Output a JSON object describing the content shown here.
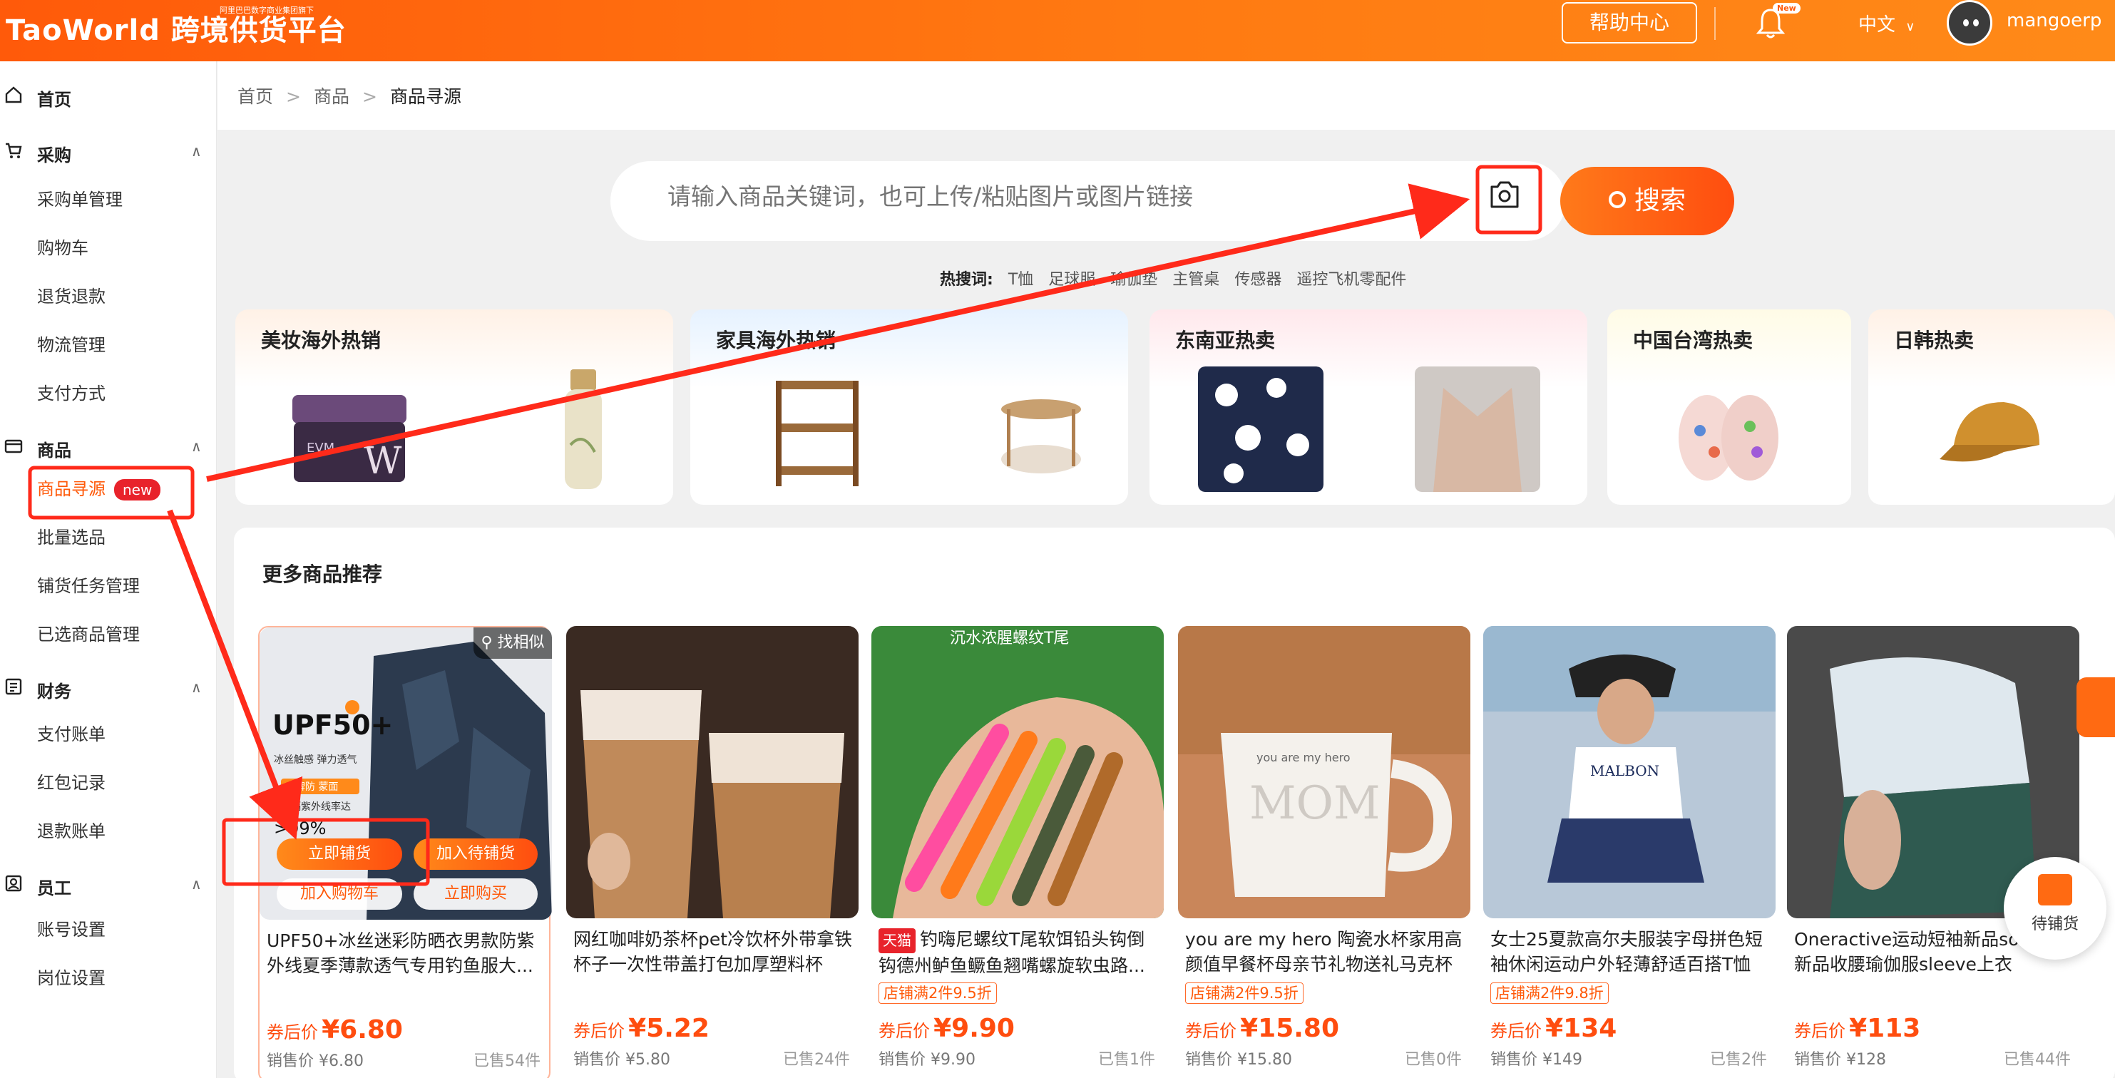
{
  "header": {
    "logo_text": "TaoWorld 跨境供货平台",
    "logo_tagline": "阿里巴巴数字商业集团旗下",
    "help_label": "帮助中心",
    "bell_badge": "New",
    "language": "中文",
    "username": "mangoerp"
  },
  "sidebar": {
    "home": "首页",
    "groups": [
      {
        "title": "采购",
        "items": [
          "采购单管理",
          "购物车",
          "退货退款",
          "物流管理",
          "支付方式"
        ]
      },
      {
        "title": "商品",
        "items": [
          "商品寻源",
          "批量选品",
          "铺货任务管理",
          "已选商品管理"
        ]
      },
      {
        "title": "财务",
        "items": [
          "支付账单",
          "红包记录",
          "退款账单"
        ]
      },
      {
        "title": "员工",
        "items": [
          "账号设置",
          "岗位设置"
        ]
      }
    ],
    "active_badge": "new"
  },
  "breadcrumb": [
    "首页",
    "商品",
    "商品寻源"
  ],
  "search": {
    "placeholder": "请输入商品关键词，也可上传/粘贴图片或图片链接",
    "button_label": "搜索",
    "hot_label": "热搜词:",
    "hot_words": [
      "T恤",
      "足球服",
      "瑜伽垫",
      "主管桌",
      "传感器",
      "遥控飞机零配件"
    ]
  },
  "categories": [
    "美妆海外热销",
    "家具海外热销",
    "东南亚热卖",
    "中国台湾热卖",
    "日韩热卖"
  ],
  "recommend": {
    "title": "更多商品推荐",
    "find_similar": "找相似",
    "btn_list_now": "立即铺货",
    "btn_add_pending": "加入待铺货",
    "btn_add_cart": "加入购物车",
    "btn_buy_now": "立即购买",
    "products": [
      {
        "title": "UPF50+冰丝迷彩防晒衣男款防紫外线夏季薄款透气专用钓鱼服大...",
        "promo": "",
        "price_label": "券后价",
        "price": "¥6.80",
        "sale_price": "销售价 ¥6.80",
        "sold": "已售54件"
      },
      {
        "title": "网红咖啡奶茶杯pet冷饮杯外带拿铁杯子一次性带盖打包加厚塑料杯",
        "promo": "",
        "price_label": "券后价",
        "price": "¥5.22",
        "sale_price": "销售价 ¥5.80",
        "sold": "已售24件"
      },
      {
        "title": "钓嗨尼螺纹T尾软饵铅头钩倒钩德州鲈鱼鳜鱼翘嘴螺旋软虫路...",
        "tmall": "天猫",
        "promo": "店铺满2件9.5折",
        "price_label": "券后价",
        "price": "¥9.90",
        "sale_price": "销售价 ¥9.90",
        "sold": "已售1件"
      },
      {
        "title": "you are my hero 陶瓷水杯家用高颜值早餐杯母亲节礼物送礼马克杯",
        "promo": "店铺满2件9.5折",
        "price_label": "券后价",
        "price": "¥15.80",
        "sale_price": "销售价 ¥15.80",
        "sold": "已售0件"
      },
      {
        "title": "女士25夏款高尔夫服装字母拼色短袖休闲运动户外轻薄舒适百搭T恤",
        "promo": "店铺满2件9.8折",
        "price_label": "券后价",
        "price": "¥134",
        "sale_price": "销售价 ¥149",
        "sold": "已售2件"
      },
      {
        "title": "Oneractive运动短袖新品sofit轻薄新品收腰瑜伽服sleeve上衣",
        "promo": "",
        "price_label": "券后价",
        "price": "¥113",
        "sale_price": "销售价 ¥128",
        "sold": "已售44件"
      }
    ],
    "image_text": {
      "upf": "UPF50+",
      "upf_sub": "冰丝触感  弹力透气",
      "upf_tag": "大牌防 蒙面",
      "upf_rate": "阻隔紫外线率达",
      "upf_pct": ">99%",
      "lure_caption": "沉水浓腥螺纹T尾",
      "mug_text": "you are my hero",
      "mug_big": "MOM",
      "polo_brand": "MALBON"
    }
  },
  "pending_float_label": "待铺货",
  "colors": {
    "brand": "#ff5a0a",
    "annotation": "#ff2a1a"
  }
}
